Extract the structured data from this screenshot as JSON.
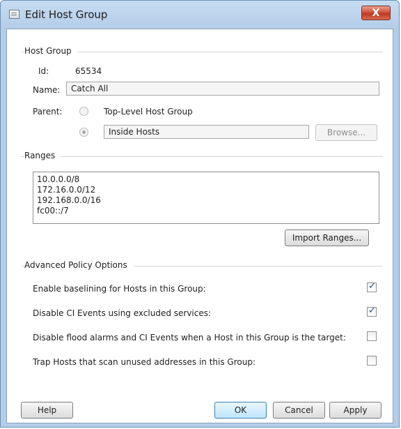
{
  "window": {
    "title": "Edit Host Group",
    "close_label": "X"
  },
  "host_group": {
    "section_title": "Host Group",
    "id_label": "Id:",
    "id_value": "65534",
    "name_label": "Name:",
    "name_value": "Catch All",
    "parent_label": "Parent:",
    "parent_option_top": "Top-Level Host Group",
    "parent_value": "Inside Hosts",
    "browse_label": "Browse..."
  },
  "ranges": {
    "section_title": "Ranges",
    "items": [
      "10.0.0.0/8",
      "172.16.0.0/12",
      "192.168.0.0/16",
      "fc00::/7"
    ],
    "import_label": "Import Ranges..."
  },
  "advanced": {
    "section_title": "Advanced Policy Options",
    "options": [
      {
        "label": "Enable baselining for Hosts in this Group:",
        "checked": true
      },
      {
        "label": "Disable CI Events using excluded services:",
        "checked": true
      },
      {
        "label": "Disable flood alarms and CI Events when a Host in this Group is the target:",
        "checked": false
      },
      {
        "label": "Trap Hosts that scan unused addresses in this Group:",
        "checked": false
      }
    ]
  },
  "footer": {
    "help": "Help",
    "ok": "OK",
    "cancel": "Cancel",
    "apply": "Apply"
  }
}
